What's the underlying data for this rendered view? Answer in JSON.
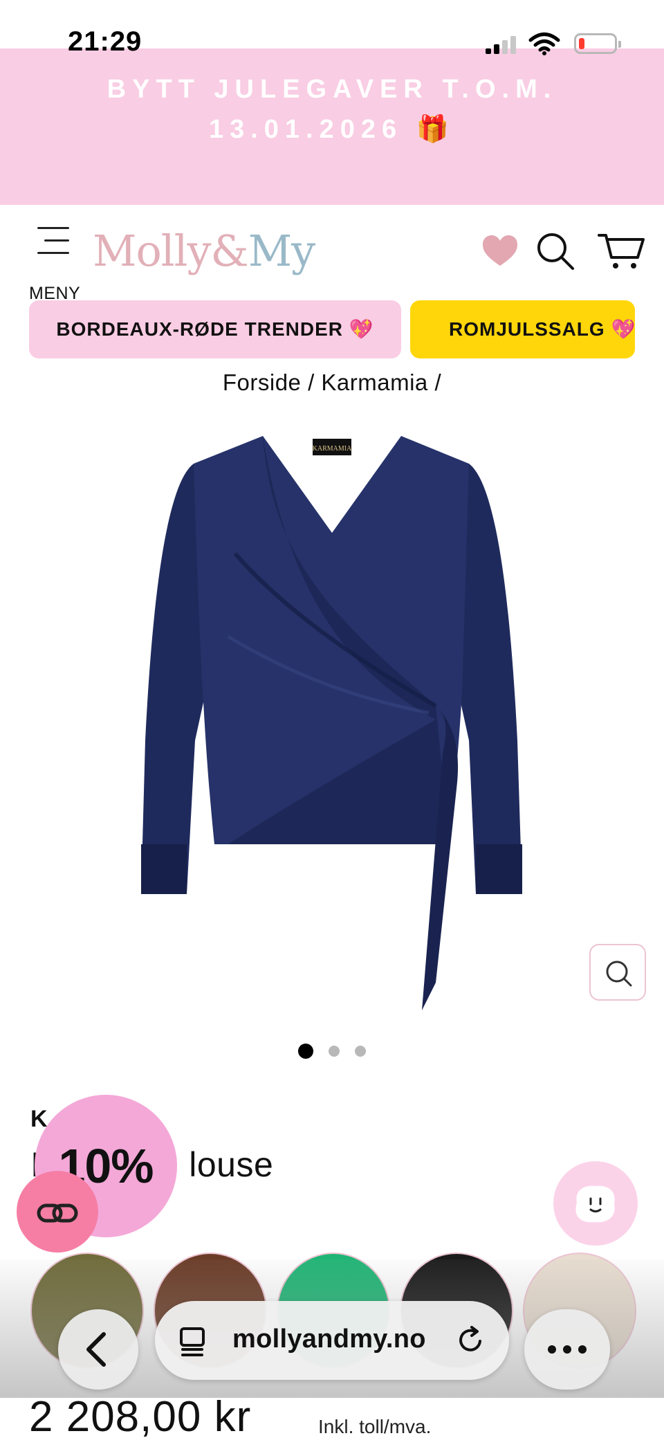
{
  "status_bar": {
    "time": "21:29"
  },
  "promo": {
    "line1": "BYTT JULEGAVER T.O.M.",
    "line2": "13.01.2026 🎁"
  },
  "header": {
    "menu_label": "MENY",
    "logo_part1": "Molly&",
    "logo_part2": "My",
    "icons": [
      "heart-icon",
      "search-icon",
      "cart-icon"
    ]
  },
  "categories": [
    {
      "label": "BORDEAUX-RØDE TRENDER 💖"
    },
    {
      "label": "ROMJULSSALG 💖 F"
    }
  ],
  "breadcrumb": "Forside / Karmamia /",
  "product": {
    "image_label": "KARMAMIA",
    "color": "#1f2a5c",
    "carousel": {
      "total": 3,
      "active": 1
    },
    "brand_visible": "K",
    "title_visible_start": "I",
    "title_visible_end": "louse",
    "price": "2 208,00 kr",
    "vat_note": "Inkl. toll/mva."
  },
  "badge": {
    "discount": "10%"
  },
  "variants": [
    {
      "name": "olive",
      "color": "#6f6b3a"
    },
    {
      "name": "brown",
      "color": "#6a3b26"
    },
    {
      "name": "green",
      "color": "#1fb575"
    },
    {
      "name": "black",
      "color": "#1a1a1a"
    },
    {
      "name": "beige",
      "color": "#e8ddd0"
    }
  ],
  "browser": {
    "url": "mollyandmy.no"
  },
  "colors": {
    "accent_pink": "#f9cde3",
    "accent_yellow": "#ffd60a",
    "badge_pink": "#f4a8d8",
    "navy": "#1f2a5c"
  }
}
